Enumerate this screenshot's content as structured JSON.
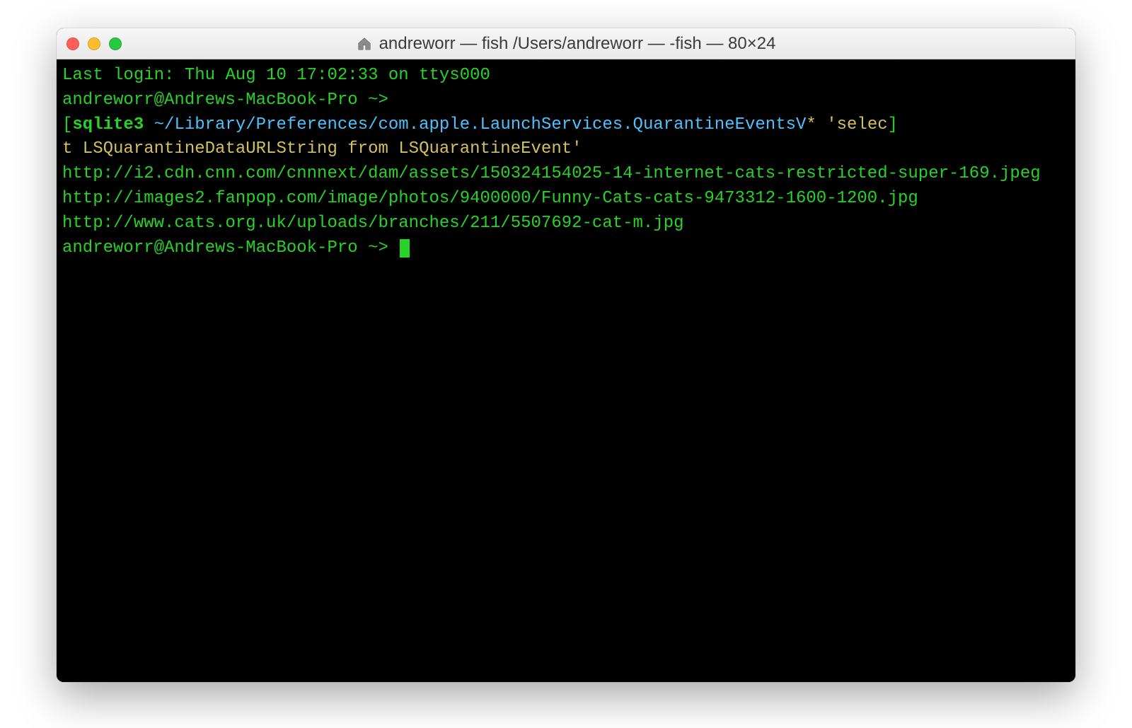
{
  "window": {
    "title": "andreworr — fish  /Users/andreworr — -fish — 80×24"
  },
  "terminal": {
    "last_login": "Last login: Thu Aug 10 17:02:33 on ttys000",
    "prompt1": "andreworr@Andrews-MacBook-Pro ~>",
    "cmd": {
      "open_bracket": "[",
      "sqlite": "sqlite3",
      "space": " ",
      "tilde": "~",
      "path": "/Library/Preferences/com.apple.LaunchServices.QuarantineEventsV",
      "star": "*",
      "query1": " 'selec",
      "close_bracket": "]",
      "query2": "t LSQuarantineDataURLString from LSQuarantineEvent'"
    },
    "output": [
      "http://i2.cdn.cnn.com/cnnnext/dam/assets/150324154025-14-internet-cats-restricted-super-169.jpeg",
      "http://images2.fanpop.com/image/photos/9400000/Funny-Cats-cats-9473312-1600-1200.jpg",
      "http://www.cats.org.uk/uploads/branches/211/5507692-cat-m.jpg"
    ],
    "prompt2": "andreworr@Andrews-MacBook-Pro ~> "
  }
}
